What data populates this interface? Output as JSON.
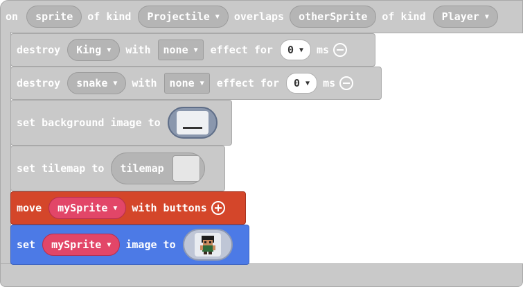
{
  "event": {
    "on": "on",
    "var1": "sprite",
    "of_kind_1": "of kind",
    "kind1": "Projectile",
    "overlaps": "overlaps",
    "var2": "otherSprite",
    "of_kind_2": "of kind",
    "kind2": "Player"
  },
  "destroy1": {
    "label": "destroy",
    "target": "King",
    "with": "with",
    "effect_value": "none",
    "effect_for": "effect for",
    "ms_value": "0",
    "ms": "ms"
  },
  "destroy2": {
    "label": "destroy",
    "target": "snake",
    "with": "with",
    "effect_value": "none",
    "effect_for": "effect for",
    "ms_value": "0",
    "ms": "ms"
  },
  "background": {
    "label": "set background image to"
  },
  "tilemap": {
    "label": "set tilemap to",
    "value": "tilemap"
  },
  "move": {
    "label": "move",
    "var": "mySprite",
    "with_buttons": "with buttons"
  },
  "setimage": {
    "label": "set",
    "var": "mySprite",
    "image_to": "image to"
  },
  "colors": {
    "grey": "#c9c9c9",
    "pill_grey": "#b5b5b5",
    "move_orange": "#d4462a",
    "set_blue": "#4c7ae6",
    "var_pink": "#e24668"
  },
  "icons": {
    "dropdown": "caret-down-icon",
    "remove": "minus-circle-icon",
    "add": "plus-circle-icon"
  }
}
